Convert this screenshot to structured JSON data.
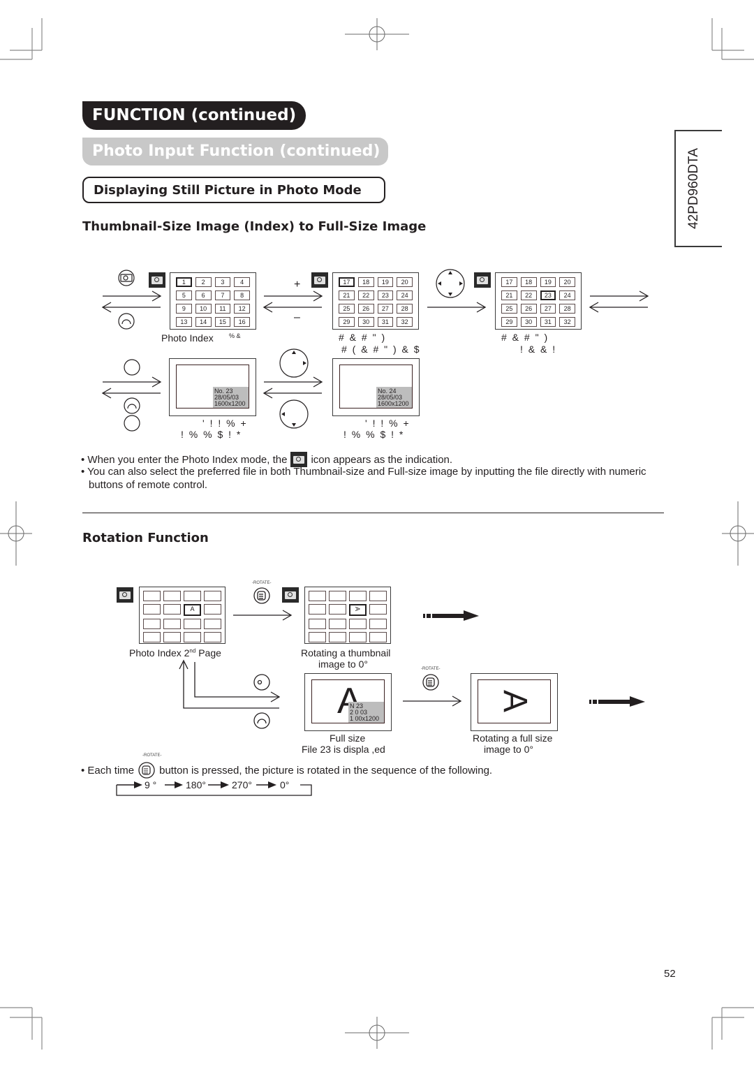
{
  "headers": {
    "function": "FUNCTION (continued)",
    "photo_input": "Photo Input Function (continued)",
    "displaying": "Displaying Still Picture in Photo Mode",
    "thumbnail_section": "Thumbnail-Size Image (Index) to Full-Size Image",
    "rotation_section": "Rotation Function"
  },
  "side_tab": {
    "model": "42PD960DTA"
  },
  "index_diagram": {
    "page1": {
      "cells": [
        "1",
        "2",
        "3",
        "4",
        "5",
        "6",
        "7",
        "8",
        "9",
        "10",
        "11",
        "12",
        "13",
        "14",
        "15",
        "16"
      ],
      "selected": "1"
    },
    "page2": {
      "cells": [
        "17",
        "18",
        "19",
        "20",
        "21",
        "22",
        "23",
        "24",
        "25",
        "26",
        "27",
        "28",
        "29",
        "30",
        "31",
        "32"
      ],
      "selected": "17"
    },
    "page2b": {
      "cells": [
        "17",
        "18",
        "19",
        "20",
        "21",
        "22",
        "23",
        "24",
        "25",
        "26",
        "27",
        "28",
        "29",
        "30",
        "31",
        "32"
      ],
      "selected": "23"
    },
    "plus_label": "+",
    "minus_label": "–",
    "caption_index": "Photo Index",
    "caption_index_glyph": "% &",
    "caption_page2_line1": "# & #   \"   )",
    "caption_page2_line2": "# (   & # \"  ) & $",
    "caption_page2b_line1": "# & #   \"   )",
    "caption_page2b_line2": "!   & &          !"
  },
  "full_diagram": {
    "image1": {
      "no": "No. 23",
      "date": "28/05/03",
      "size": "1600x1200"
    },
    "image2": {
      "no": "No. 24",
      "date": "28/05/03",
      "size": "1600x1200"
    },
    "caption1_line1": "' ! !  %   +",
    "caption1_line2": "!          %      % $ !   *",
    "caption2_line1": "' ! !  %   +",
    "caption2_line2": "!          %      % $ !   *"
  },
  "bullets": {
    "b1_before": "• When you enter the Photo Index mode, the",
    "b1_after": "icon appears as the indication.",
    "b2": "• You can also select the preferred file in both Thumbnail-size and Full-size image by inputting the file directly with numeric buttons of remote control."
  },
  "rotation": {
    "rotate_label": "-ROTATE-",
    "cell_letter": "A",
    "caption_index": "Photo Index   2",
    "caption_index_sup": "nd",
    "caption_index_after": " Page",
    "caption_thumb_line1": "Rotating a thumbnail",
    "caption_thumb_line2": "image to   0°",
    "full_info": {
      "no": "N     23",
      "date": "2    0    03",
      "size": "1   00x1200"
    },
    "caption_full_line1": "Full size",
    "caption_full_line2": "File  23 is displa ,ed",
    "caption_rot_full_line1": "Rotating a full size",
    "caption_rot_full_line2": "image to   0°",
    "bullet_before": "• Each time",
    "bullet_after": "button is pressed, the picture is rotated in the sequence of the following.",
    "sequence": [
      "9  °",
      "180°",
      "270°",
      "0°"
    ]
  },
  "page_number": "52"
}
